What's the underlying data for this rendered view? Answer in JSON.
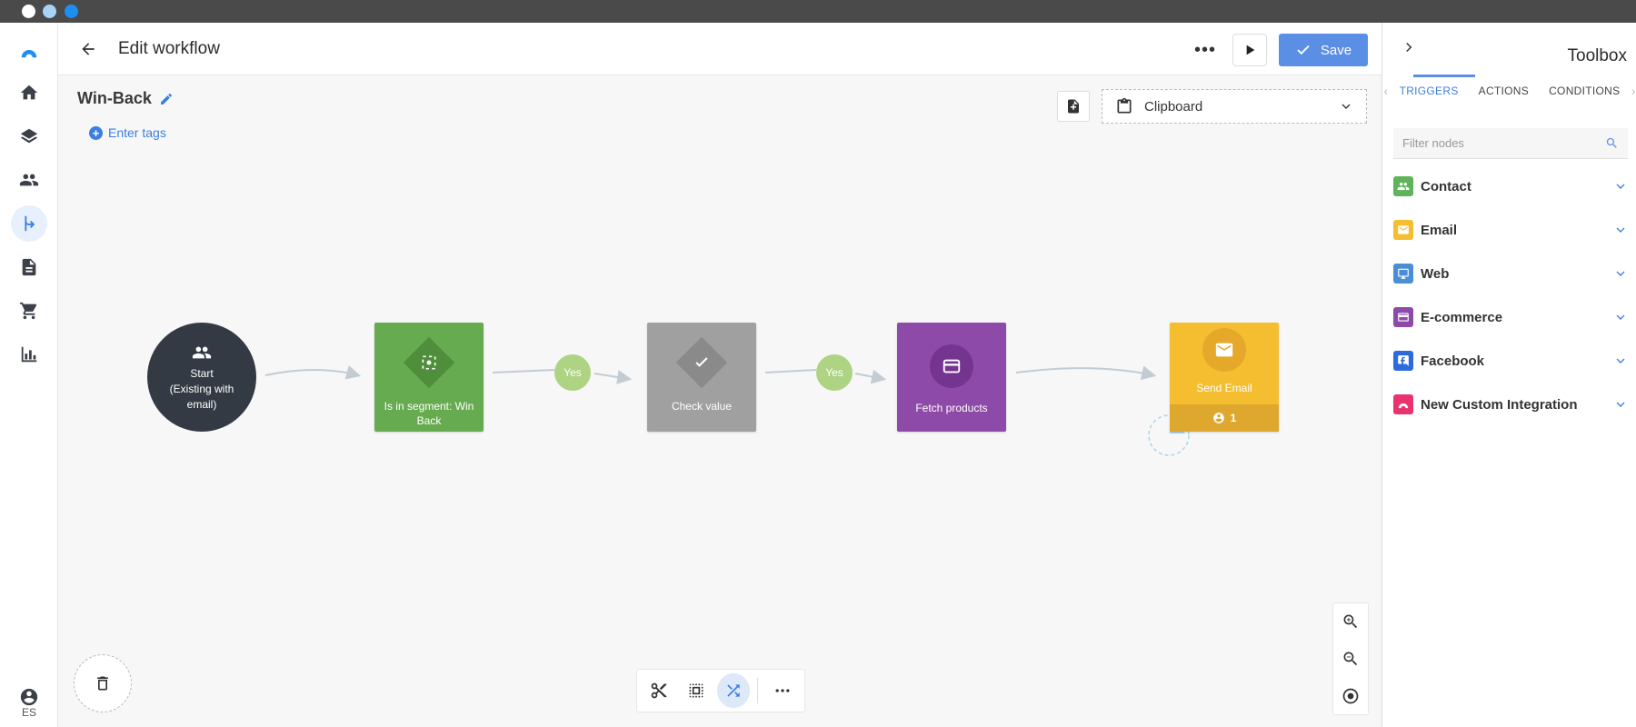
{
  "window": {
    "dots": [
      "#ffffff",
      "#a7d4f6",
      "#1f8ef1"
    ]
  },
  "header": {
    "title": "Edit workflow",
    "more_label": "•••",
    "save_label": "Save"
  },
  "rail": {
    "lang": "ES",
    "items": [
      "logo-icon",
      "home-icon",
      "layers-icon",
      "users-icon",
      "workflow-icon",
      "document-icon",
      "cart-icon",
      "chart-icon"
    ]
  },
  "canvas": {
    "workflow_name": "Win-Back",
    "tags_label": "Enter tags",
    "clipboard_label": "Clipboard"
  },
  "nodes": {
    "start": {
      "line1": "Start",
      "line2": "(Existing with email)",
      "color": "#343a43"
    },
    "segment": {
      "label": "Is in segment: Win Back",
      "color": "#67ab50"
    },
    "yes1": "Yes",
    "check": {
      "label": "Check value",
      "color": "#a0a0a0"
    },
    "yes2": "Yes",
    "fetch": {
      "label": "Fetch products",
      "color": "#8e4aa8"
    },
    "email": {
      "label": "Send Email",
      "count": "1",
      "color": "#f5bd30"
    }
  },
  "toolbox": {
    "title": "Toolbox",
    "tabs": [
      "TRIGGERS",
      "ACTIONS",
      "CONDITIONS"
    ],
    "active_tab": "TRIGGERS",
    "filter_placeholder": "Filter nodes",
    "categories": [
      {
        "label": "Contact",
        "color": "#5fb35a"
      },
      {
        "label": "Email",
        "color": "#f5bd30"
      },
      {
        "label": "Web",
        "color": "#4a8fd6"
      },
      {
        "label": "E-commerce",
        "color": "#8e4aa8"
      },
      {
        "label": "Facebook",
        "color": "#2d6bdd"
      },
      {
        "label": "New Custom Integration",
        "color": "#e8336f"
      }
    ]
  }
}
